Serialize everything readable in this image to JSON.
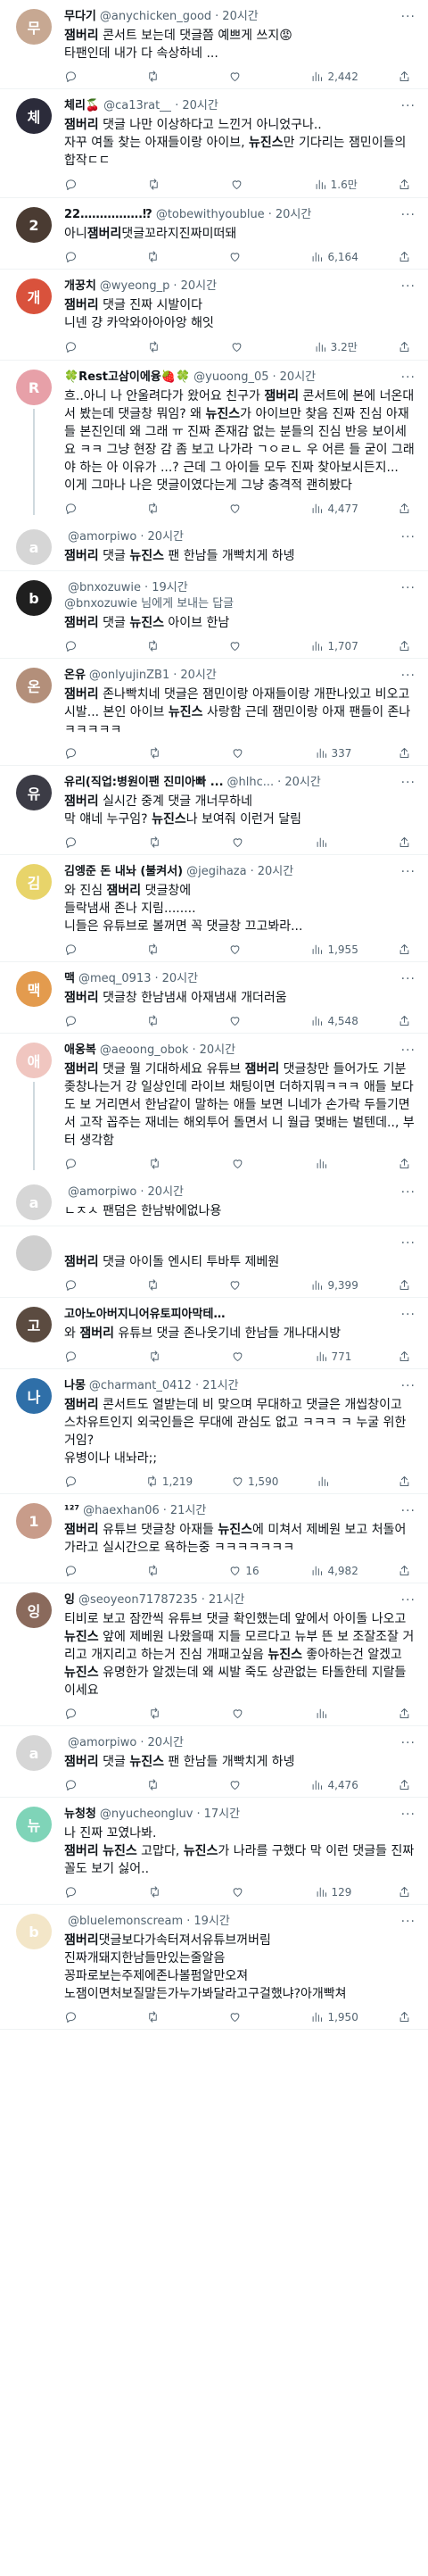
{
  "tweets": [
    {
      "name": "무다기",
      "handle": "@anychicken_good",
      "time": "20시간",
      "text": "잼버리 콘서트 보는데 댓글쯤 예쁘게 쓰지😡\n타팬인데 내가 다 속상하네 ...",
      "replies": "",
      "retweets": "",
      "likes": "",
      "views": "2,442",
      "avatar_color": "#c7a892",
      "avatar_glyph": "무"
    },
    {
      "name": "체리🍒",
      "handle": "@ca13rat__",
      "time": "20시간",
      "text": "잼버리 댓글 나만 이상하다고 느낀거 아니었구나..\n자꾸 여돌 찾는 아재들이랑 아이브, 뉴진스만 기다리는 잼민이들의 합작ㄷㄷ",
      "replies": "",
      "retweets": "",
      "likes": "",
      "views": "1.6만",
      "avatar_color": "#2b2b3a",
      "avatar_glyph": "체"
    },
    {
      "name": "22…………….⁉",
      "handle": "@tobewithyoublue",
      "time": "20시간",
      "text": "아니잼버리댓글꼬라지진짜미떠돼",
      "replies": "",
      "retweets": "",
      "likes": "",
      "views": "6,164",
      "avatar_color": "#4a3b32",
      "avatar_glyph": "2"
    },
    {
      "name": "개꿍치",
      "handle": "@wyeong_p",
      "time": "20시간",
      "text": "잼버리 댓글 진짜 시발이다\n니넨 걍 카악와아아아앙 해잇",
      "replies": "",
      "retweets": "",
      "likes": "",
      "views": "3.2만",
      "avatar_color": "#d9523c",
      "avatar_glyph": "개"
    },
    {
      "name": "🍀Rest고삼이에융🍓🍀",
      "handle": "@yuoong_05",
      "time": "20시간",
      "text": "흐..아니 나 안울려다가 왔어요 친구가 잼버리 콘서트에 본에 너온대서 봤는데 댓글창 뭐임? 왜 뉴진스가 아이브만 찾음 진짜 진심 아재들 본진인데 왜 그래 ㅠ 진짜 존재감 없는 분들의 진심 반응 보이세요 ㅋㅋ 그냥 현장 감 좀 보고 나가라 ㄱㅇㄹㄴ 우 어른 들 굳이 그래야 하는 아 이유가 ...? 근데 그 아이들 모두 진짜 찾아보시든지...\n이게 그마나 나은 댓글이였다는게 그냥 충격적 괜히봤다",
      "replies": "",
      "retweets": "",
      "likes": "",
      "views": "4,477",
      "avatar_color": "#e7a0a8",
      "avatar_glyph": "R"
    },
    {
      "name": "",
      "handle": "@amorpiwo",
      "time": "20시간",
      "text": "잼버리 댓글 뉴진스 팬 한남들 개빡치게 하넹",
      "replies": "",
      "retweets": "",
      "likes": "",
      "views": "",
      "avatar_color": "#d6d6d6",
      "avatar_glyph": "a",
      "threaded_from_prev": true,
      "hide_actions": true
    },
    {
      "name": "",
      "handle": "@bnxozuwie",
      "time": "19시간",
      "reply_to": "@bnxozuwie 님에게 보내는 답글",
      "text": "잼버리 댓글 뉴진스 아이브 한남",
      "replies": "",
      "retweets": "",
      "likes": "",
      "views": "1,707",
      "avatar_color": "#1f1f1f",
      "avatar_glyph": "b"
    },
    {
      "name": "온유",
      "handle": "@onlyujinZB1",
      "time": "20시간",
      "text": "잼버리 존나빡치네 댓글은 잼민이랑 아재들이랑 개판나있고 비오고 시발... 본인 아이브 뉴진스 사랑함 근데 잼민이랑 아재 팬들이 존나ㅋㅋㅋㅋㅋ",
      "replies": "",
      "retweets": "",
      "likes": "",
      "views": "337",
      "avatar_color": "#b38f7a",
      "avatar_glyph": "온"
    },
    {
      "name": "유리(직업:병원이팬 진미아빠 ...",
      "handle": "@hlhc...",
      "time": "20시간",
      "text": "잼버리 실시간 중계 댓글 개너무하네\n막 얘네 누구임? 뉴진스나 보여줘 이런거 달림",
      "replies": "",
      "retweets": "",
      "likes": "",
      "views": "",
      "avatar_color": "#3c3c46",
      "avatar_glyph": "유"
    },
    {
      "name": "김엥준 돈 내놔 (불켜서)",
      "handle": "@jegihaza",
      "time": "20시간",
      "text": "와 진심 잼버리 댓글창에\n들락냄새 존나 지림........\n니들은 유튜브로 볼꺼면 꼭 댓글창 끄고봐라...",
      "replies": "",
      "retweets": "",
      "likes": "",
      "views": "1,955",
      "avatar_color": "#e8d46a",
      "avatar_glyph": "김"
    },
    {
      "name": "맥",
      "handle": "@meq_0913",
      "time": "20시간",
      "text": "잼버리 댓글창 한남냄새 아재냄새 개더러움",
      "replies": "",
      "retweets": "",
      "likes": "",
      "views": "4,548",
      "avatar_color": "#e39b4e",
      "avatar_glyph": "맥"
    },
    {
      "name": "애옹복",
      "handle": "@aeoong_obok",
      "time": "20시간",
      "text": "잼버리 댓글 뭘 기대하세요 유튜브 잼버리 댓글창만 들어가도 기분좆창나는거 강 일상인데 라이브 채팅이면 더하지뭐ㅋㅋㅋ 애들 보다도 보 거리면서 한남같이 말하는 애들 보면 니네가 손가락 두들기면서 고작 꼽주는 재네는 해외투어 돌면서 니 월급 몇배는 벌텐데.., 부터 생각함",
      "replies": "",
      "retweets": "",
      "likes": "",
      "views": "",
      "avatar_color": "#f0c6c0",
      "avatar_glyph": "애"
    },
    {
      "name": "",
      "handle": "@amorpiwo",
      "time": "20시간",
      "text": "ㄴㅈㅅ 팬덤은 한남밖에없나용",
      "replies": "",
      "retweets": "",
      "likes": "",
      "views": "",
      "avatar_color": "#d6d6d6",
      "avatar_glyph": "a",
      "threaded_from_prev": true,
      "hide_actions": true
    },
    {
      "name": "",
      "handle": "",
      "time": "",
      "text": "잼버리 댓글 아이돌 엔시티 투바투 제베원",
      "replies": "",
      "retweets": "",
      "likes": "",
      "views": "9,399",
      "avatar_color": "#cfcfcf",
      "avatar_glyph": ""
    },
    {
      "name": "고아노아버지니어유토피아막테리아이...",
      "handle": "",
      "time": "",
      "text": "와 잼버리 유튜브 댓글 존나웃기네 한남들 개나대시방",
      "replies": "",
      "retweets": "",
      "likes": "",
      "views": "771",
      "avatar_color": "#5b4b40",
      "avatar_glyph": "고"
    },
    {
      "name": "나몽",
      "handle": "@charmant_0412",
      "time": "21시간",
      "text": "잼버리 콘서트도 열받는데 비 맞으며 무대하고 댓글은 개씹창이고 스차유트인지 외국인들은 무대에 관심도 없고 ㅋㅋㅋ ㅋ 누굴 위한 거임?\n유병이나 내놔라;;",
      "replies": "",
      "retweets": "1,219",
      "likes": "1,590",
      "views": "",
      "avatar_color": "#2f6fa8",
      "avatar_glyph": "나"
    },
    {
      "name": "¹²⁷",
      "handle": "@haexhan06",
      "time": "21시간",
      "text": "잼버리 유튜브 댓글창 아재들 뉴진스에 미쳐서 제베원 보고 처돌어가라고 실시간으로 욕하는중 ㅋㅋㅋㅋㅋㅋㅋ",
      "replies": "",
      "retweets": "",
      "likes": "16",
      "views": "4,982",
      "avatar_color": "#c89c8a",
      "avatar_glyph": "1"
    },
    {
      "name": "잉",
      "handle": "@seoyeon71787235",
      "time": "21시간",
      "text": "티비로 보고 잠깐씩 유튜브 댓글 확인했는데 앞에서 아이돌 나오고 뉴진스 앞에 제베원 나왔을때 지들 모르다고 뉴부 뜬 보 조잘조잘 거리고 개지리고 하는거 진심 개패고싶음 뉴진스 좋아하는건 알겠고 뉴진스 유명한가 알겠는데 왜 씨발 죽도 상관없는 타돌한테 지랄들이세요",
      "replies": "",
      "retweets": "",
      "likes": "",
      "views": "",
      "avatar_color": "#8a6a5c",
      "avatar_glyph": "잉"
    },
    {
      "name": "",
      "handle": "@amorpiwo",
      "time": "20시간",
      "text": "잼버리 댓글 뉴진스 팬 한남들 개빡치게 하넹",
      "replies": "",
      "retweets": "",
      "likes": "",
      "views": "4,476",
      "avatar_color": "#d6d6d6",
      "avatar_glyph": "a"
    },
    {
      "name": "뉴청청",
      "handle": "@nyucheongluv",
      "time": "17시간",
      "text": "나 진짜 꼬였나봐.\n잼버리 뉴진스 고맙다, 뉴진스가 나라를 구했다 막 이런 댓글들 진짜 꼴도 보기 싫어..",
      "replies": "",
      "retweets": "",
      "likes": "",
      "views": "129",
      "avatar_color": "#7fd4b8",
      "avatar_glyph": "뉴"
    },
    {
      "name": "",
      "handle": "@bluelemonscream",
      "time": "19시간",
      "text": "잼버리댓글보다가속터져서유튜브꺼버림\n진짜개돼지한남들만있는줄알음\n꽁파로보는주제에존나볼펌알만오져\n노잼이면처보질말든가누가봐달라고구걸했냐?아개빡쳐",
      "replies": "",
      "retweets": "",
      "likes": "",
      "views": "1,950",
      "avatar_color": "#f3e6c8",
      "avatar_glyph": "b"
    }
  ],
  "icons": {
    "reply": "reply-icon",
    "retweet": "retweet-icon",
    "like": "heart-icon",
    "views": "views-icon",
    "share": "share-icon",
    "more": "more-options-icon"
  },
  "colors": {
    "text": "#0f1419",
    "muted": "#536471",
    "link": "#1d9bf0",
    "divider": "#eff3f4"
  }
}
